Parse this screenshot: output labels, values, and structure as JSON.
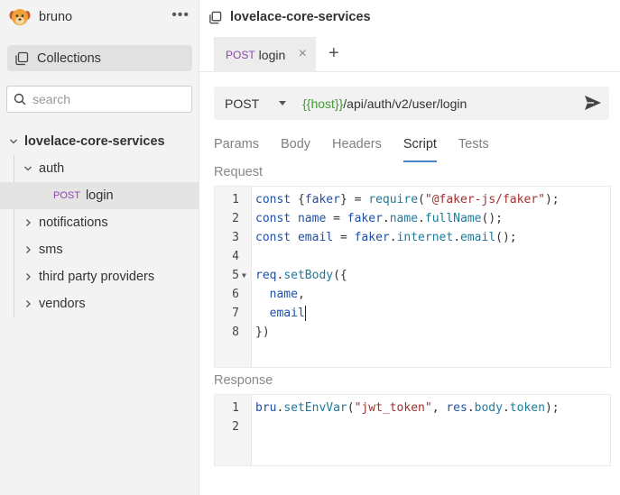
{
  "app": {
    "name": "bruno"
  },
  "sidebar": {
    "collections_label": "Collections",
    "search_placeholder": "search",
    "collection_name": "lovelace-core-services",
    "folder_auth": "auth",
    "request": {
      "method": "POST",
      "name": "login"
    },
    "folders": [
      "notifications",
      "sms",
      "third party providers",
      "vendors"
    ]
  },
  "main": {
    "title": "lovelace-core-services",
    "tab": {
      "method": "POST",
      "name": "login"
    },
    "url": {
      "method": "POST",
      "host_var": "{{host}}",
      "path": "/api/auth/v2/user/login"
    },
    "subtabs": [
      "Params",
      "Body",
      "Headers",
      "Script",
      "Tests"
    ],
    "active_subtab": "Script",
    "request_label": "Request",
    "response_label": "Response",
    "request_line_numbers": [
      "1",
      "2",
      "3",
      "4",
      "5",
      "6",
      "7",
      "8"
    ],
    "response_line_numbers": [
      "1",
      "2"
    ]
  },
  "colors": {
    "post": "#8e44ad",
    "host_var": "#3e9a2f",
    "active_tab_underline": "#4a86c5"
  },
  "icons": [
    "bruno-logo-icon",
    "kebab-menu-icon",
    "collections-icon",
    "search-icon",
    "chevron-down-icon",
    "chevron-right-icon",
    "copy-icon",
    "close-icon",
    "plus-icon",
    "dropdown-caret-icon",
    "send-icon",
    "fold-arrow-icon"
  ]
}
